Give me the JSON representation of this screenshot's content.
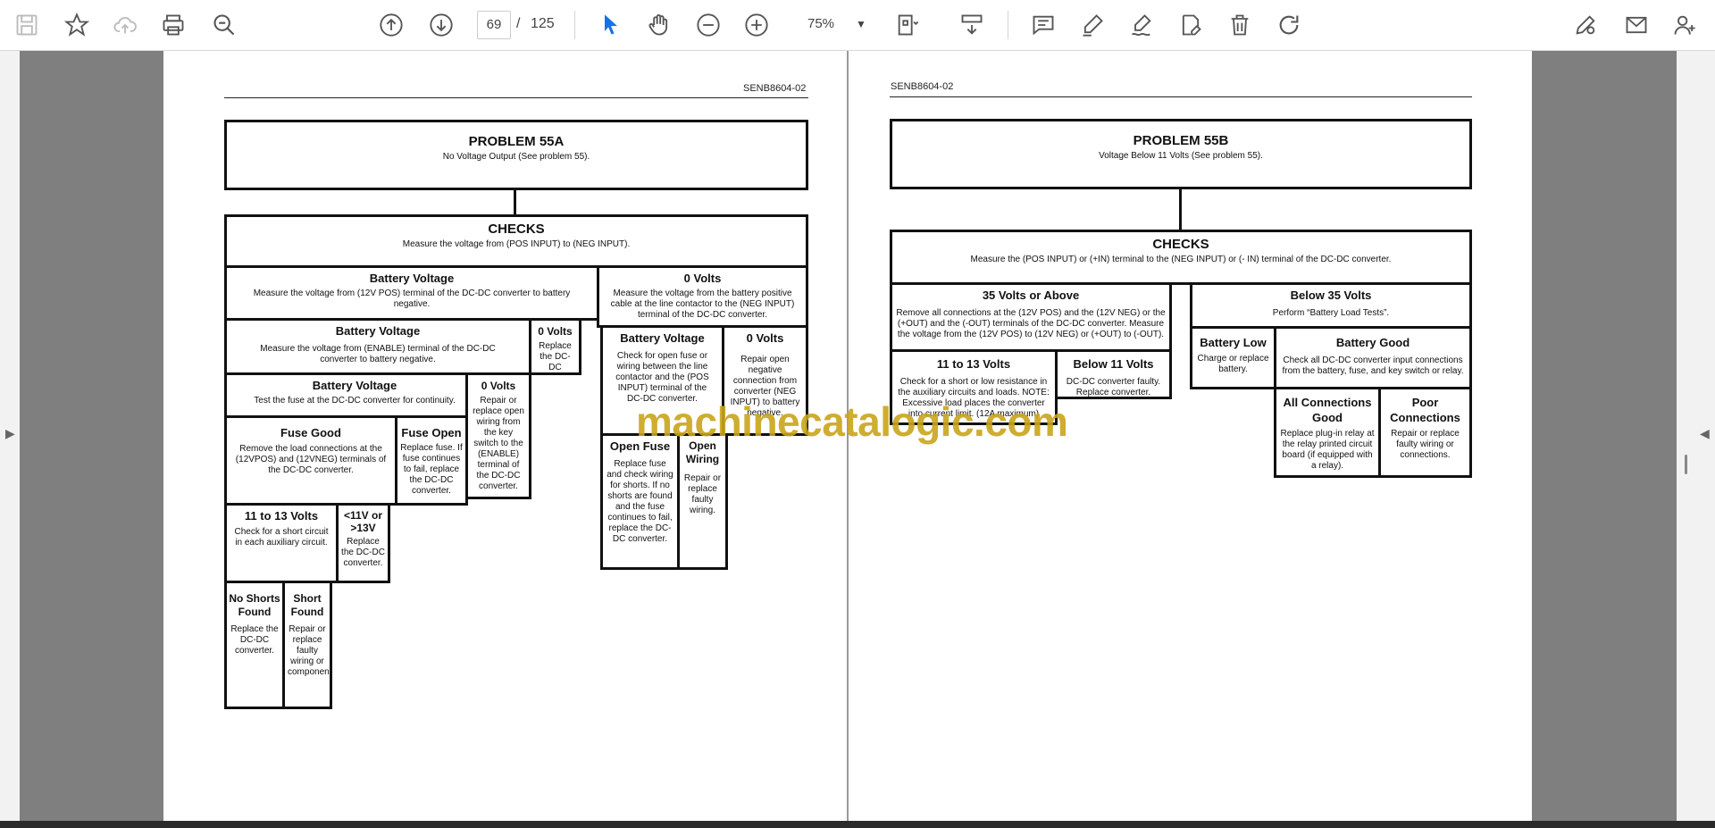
{
  "toolbar": {
    "page_current": "69",
    "page_separator": "/",
    "page_total": "125",
    "zoom": "75%",
    "icons": [
      "save-icon",
      "bookmark-star-icon",
      "upload-cloud-icon",
      "print-icon",
      "search-zoom-icon",
      "page-up-icon",
      "page-down-icon",
      "select-cursor-icon",
      "hand-icon",
      "zoom-out-icon",
      "zoom-in-icon",
      "fit-page-icon",
      "scroll-mode-icon",
      "comment-icon",
      "highlight-pen-icon",
      "sign-icon",
      "edit-pdf-icon",
      "delete-icon",
      "rotate-icon",
      "share-link-icon",
      "email-icon",
      "add-user-icon"
    ]
  },
  "left_page": {
    "doc_id": "SENB8604-02",
    "problem": {
      "title": "PROBLEM 55A",
      "text": "No Voltage Output (See problem 55)."
    },
    "checks": {
      "title": "CHECKS",
      "text": "Measure the voltage from (POS INPUT) to (NEG INPUT)."
    },
    "bv1": {
      "title": "Battery Voltage",
      "text": "Measure the voltage from (12V POS) terminal of the DC-DC converter to battery negative."
    },
    "zv1": {
      "title": "0 Volts",
      "text": "Measure the voltage from the battery positive cable at the line contactor to the (NEG INPUT) terminal of the DC-DC converter."
    },
    "bv2": {
      "title": "Battery Voltage",
      "text": "Measure the voltage from (ENABLE) terminal of the DC-DC converter to battery negative."
    },
    "zv2": {
      "title": "0 Volts",
      "text": "Replace the DC-DC converter."
    },
    "bv3": {
      "title": "Battery Voltage",
      "text": "Test the fuse at the DC-DC converter for continuity."
    },
    "zv3": {
      "title": "0 Volts",
      "text": "Repair or replace open wiring from the key switch to the (ENABLE) terminal of the DC-DC converter."
    },
    "fuse_good": {
      "title": "Fuse Good",
      "text": "Remove the load connections at the (12VPOS) and (12VNEG) terminals of the DC-DC converter."
    },
    "fuse_open": {
      "title": "Fuse Open",
      "text": "Replace fuse. If fuse continues to fail, replace the DC-DC converter."
    },
    "bv4": {
      "title": "Battery Voltage",
      "text": "Check for open fuse or wiring between the line contactor and the (POS INPUT) terminal of the DC-DC converter."
    },
    "zv4": {
      "title": "0 Volts",
      "text": "Repair open negative connection from converter (NEG INPUT) to battery negative."
    },
    "v11_13": {
      "title": "11 to 13 Volts",
      "text": "Check for a short circuit in each auxiliary circuit."
    },
    "lt11": {
      "title": "<11V or >13V",
      "text": "Replace the DC-DC converter."
    },
    "open_fuse": {
      "title": "Open Fuse",
      "text": "Replace fuse and check wiring for shorts. If no shorts are found and the fuse continues to fail, replace the DC-DC converter."
    },
    "open_wiring": {
      "title": "Open Wiring",
      "text": "Repair or replace faulty wiring."
    },
    "no_shorts": {
      "title": "No Shorts Found",
      "text": "Replace the DC-DC converter."
    },
    "short_found": {
      "title": "Short Found",
      "text": "Repair or replace faulty wiring or components."
    }
  },
  "right_page": {
    "doc_id": "SENB8604-02",
    "problem": {
      "title": "PROBLEM 55B",
      "text": "Voltage Below 11 Volts (See problem 55)."
    },
    "checks": {
      "title": "CHECKS",
      "text": "Measure the (POS INPUT) or (+IN) terminal to the (NEG INPUT) or (- IN) terminal of the DC-DC converter."
    },
    "v35_above": {
      "title": "35 Volts or Above",
      "text": "Remove all connections at the (12V POS) and the (12V NEG) or the (+OUT) and the (-OUT) terminals of the DC-DC converter. Measure the voltage from the (12V POS) to (12V NEG) or (+OUT) to (-OUT)."
    },
    "below35": {
      "title": "Below 35 Volts",
      "text": "Perform “Battery Load Tests”."
    },
    "v11_13": {
      "title": "11 to 13 Volts",
      "text": "Check for a short or low resistance in the auxiliary circuits and loads. NOTE: Excessive load places the converter into current limit. (12A maximum)"
    },
    "below11": {
      "title": "Below 11 Volts",
      "text": "DC-DC converter faulty. Replace converter."
    },
    "battery_low": {
      "title": "Battery Low",
      "text": "Charge or replace battery."
    },
    "battery_good": {
      "title": "Battery Good",
      "text": "Check all DC-DC converter input connections from the battery, fuse, and key switch or relay."
    },
    "all_good": {
      "title": "All Connections Good",
      "text": "Replace plug-in relay at the relay printed circuit board (if equipped with a relay)."
    },
    "poor_conn": {
      "title": "Poor Connections",
      "text": "Repair or replace faulty wiring or connections."
    }
  },
  "watermark": "machinecatalogic.com",
  "colors": {
    "accent": "#1473e6",
    "watermark": "#c9a51a",
    "viewport_bg": "#7f7f7f"
  }
}
